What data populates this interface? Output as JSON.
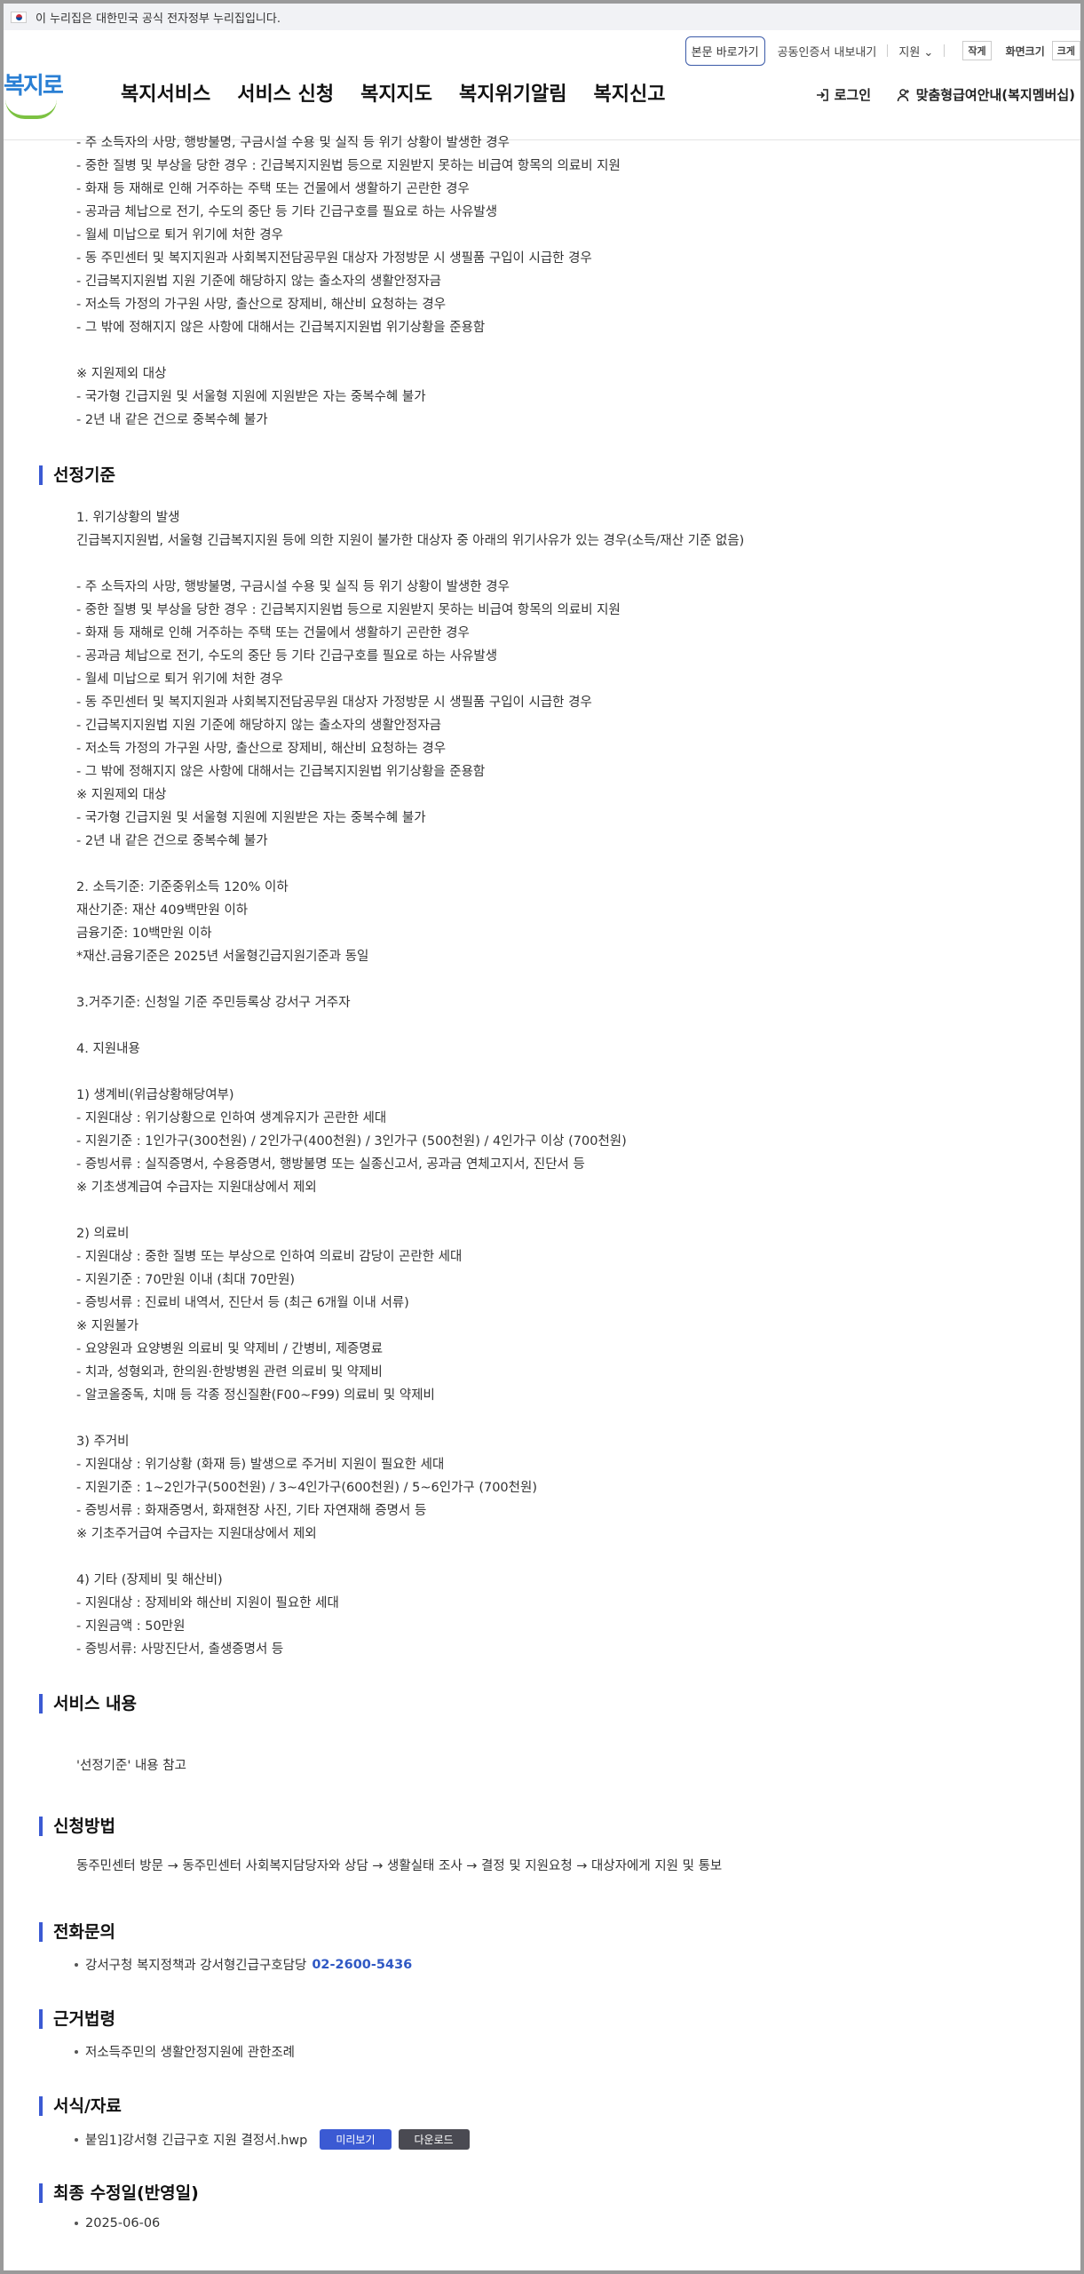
{
  "gov_banner": {
    "text": "이 누리집은 대한민국 공식 전자정부 누리집입니다."
  },
  "utility": {
    "skip": "본문 바로가기",
    "cert": "공동인증서 내보내기",
    "support": "지원",
    "small": "작게",
    "screen_size": "화면크기",
    "large": "크게"
  },
  "logo": {
    "text": "복지로"
  },
  "nav": [
    "복지서비스",
    "서비스 신청",
    "복지지도",
    "복지위기알림",
    "복지신고"
  ],
  "header_right": {
    "login": "로그인",
    "custom": "맞춤형급여안내(복지멤버십)"
  },
  "top_lines": [
    "- 주 소득자의 사망, 행방불명, 구금시설 수용 및 실직 등 위기 상황이 발생한 경우",
    "- 중한 질병 및 부상을 당한 경우 : 긴급복지지원법 등으로 지원받지 못하는 비급여 항목의 의료비 지원",
    "- 화재 등 재해로 인해 거주하는 주택 또는 건물에서 생활하기 곤란한 경우",
    "- 공과금 체납으로 전기, 수도의 중단 등 기타 긴급구호를 필요로 하는 사유발생",
    "- 월세 미납으로 퇴거 위기에 처한 경우",
    "- 동 주민센터 및 복지지원과 사회복지전담공무원 대상자 가정방문 시 생필품 구입이 시급한 경우",
    "- 긴급복지지원법 지원 기준에 해당하지 않는 출소자의 생활안정자금",
    "- 저소득 가정의 가구원 사망, 출산으로 장제비, 해산비 요청하는 경우",
    "- 그 밖에 정해지지 않은 사항에 대해서는 긴급복지지원법 위기상황을 준용함",
    "",
    "※ 지원제외 대상",
    "- 국가형 긴급지원 및 서울형 지원에 지원받은 자는 중복수혜 불가",
    "- 2년 내 같은 건으로 중복수혜 불가"
  ],
  "sections": {
    "criteria": {
      "title": "선정기준",
      "lines": [
        "1. 위기상황의 발생",
        "긴급복지지원법, 서울형 긴급복지지원 등에 의한 지원이 불가한 대상자 중 아래의 위기사유가 있는 경우(소득/재산 기준 없음)",
        "",
        "- 주 소득자의 사망, 행방불명, 구금시설 수용 및 실직 등 위기 상황이 발생한 경우",
        "- 중한 질병 및 부상을 당한 경우 : 긴급복지지원법 등으로 지원받지 못하는 비급여 항목의 의료비 지원",
        "- 화재 등 재해로 인해 거주하는 주택 또는 건물에서 생활하기 곤란한 경우",
        "- 공과금 체납으로 전기, 수도의 중단 등 기타 긴급구호를 필요로 하는 사유발생",
        "- 월세 미납으로 퇴거 위기에 처한 경우",
        "- 동 주민센터 및 복지지원과 사회복지전담공무원 대상자 가정방문 시 생필품 구입이 시급한 경우",
        "- 긴급복지지원법 지원 기준에 해당하지 않는 출소자의 생활안정자금",
        "- 저소득 가정의 가구원 사망, 출산으로 장제비, 해산비 요청하는 경우",
        "- 그 밖에 정해지지 않은 사항에 대해서는 긴급복지지원법 위기상황을 준용함",
        "※ 지원제외 대상",
        "- 국가형 긴급지원 및 서울형 지원에 지원받은 자는 중복수혜 불가",
        "- 2년 내 같은 건으로 중복수혜 불가",
        "",
        "2. 소득기준: 기준중위소득 120% 이하",
        "재산기준: 재산 409백만원 이하",
        "금융기준: 10백만원 이하",
        "*재산.금융기준은 2025년 서울형긴급지원기준과 동일",
        "",
        "3.거주기준: 신청일 기준 주민등록상 강서구 거주자",
        "",
        "4. 지원내용",
        "",
        "1) 생계비(위급상황해당여부)",
        "- 지원대상 : 위기상황으로 인하여 생계유지가 곤란한 세대",
        "- 지원기준 : 1인가구(300천원) / 2인가구(400천원) / 3인가구 (500천원) / 4인가구 이상 (700천원)",
        "- 증빙서류 : 실직증명서, 수용증명서, 행방불명 또는 실종신고서, 공과금 연체고지서, 진단서 등",
        "※ 기초생계급여 수급자는 지원대상에서 제외",
        "",
        "2) 의료비",
        "- 지원대상 : 중한 질병 또는 부상으로 인하여 의료비 감당이 곤란한 세대",
        "- 지원기준 : 70만원 이내 (최대 70만원)",
        "- 증빙서류 : 진료비 내역서, 진단서 등 (최근 6개월 이내 서류)",
        "※ 지원불가",
        "- 요양원과 요양병원 의료비 및 약제비 / 간병비, 제증명료",
        "- 치과, 성형외과, 한의원·한방병원 관련 의료비 및 약제비",
        "- 알코올중독, 치매 등 각종 정신질환(F00~F99) 의료비 및 약제비",
        "",
        "3) 주거비",
        "- 지원대상 : 위기상황 (화재 등) 발생으로 주거비 지원이 필요한 세대",
        "- 지원기준 : 1~2인가구(500천원) / 3~4인가구(600천원) / 5~6인가구 (700천원)",
        "- 증빙서류 : 화재증명서, 화재현장 사진, 기타 자연재해 증명서 등",
        "※ 기초주거급여 수급자는 지원대상에서 제외",
        "",
        "4) 기타 (장제비 및 해산비)",
        "- 지원대상 : 장제비와 해산비 지원이 필요한 세대",
        "- 지원금액 : 50만원",
        "- 증빙서류: 사망진단서, 출생증명서 등"
      ]
    },
    "service": {
      "title": "서비스 내용",
      "text": "'선정기준' 내용 참고"
    },
    "apply": {
      "title": "신청방법",
      "text": "동주민센터 방문 → 동주민센터 사회복지담당자와 상담 → 생활실태 조사 → 결정 및 지원요청 → 대상자에게 지원 및 통보"
    },
    "contact": {
      "title": "전화문의",
      "text": "강서구청 복지정책과 강서형긴급구호담당",
      "phone": "02-2600-5436"
    },
    "law": {
      "title": "근거법령",
      "text": "저소득주민의 생활안정지원에 관한조례"
    },
    "forms": {
      "title": "서식/자료",
      "file": "붙임1]강서형 긴급구호 지원 결정서.hwp",
      "preview": "미리보기",
      "download": "다운로드"
    },
    "updated": {
      "title": "최종 수정일(반영일)",
      "date": "2025-06-06"
    }
  }
}
